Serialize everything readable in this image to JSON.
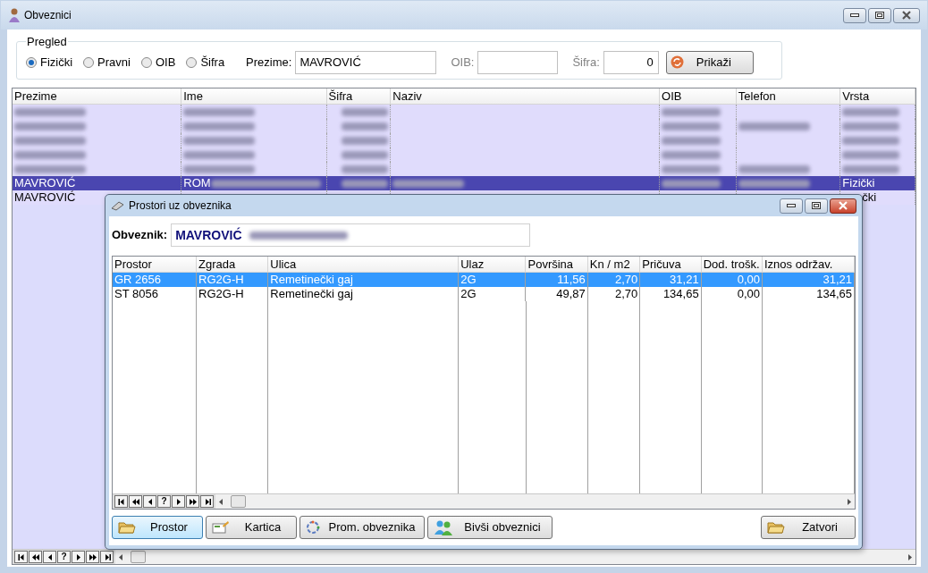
{
  "window": {
    "title": "Obveznici"
  },
  "filter": {
    "title": "Pregled",
    "radios": [
      {
        "label": "Fizički",
        "selected": true
      },
      {
        "label": "Pravni",
        "selected": false
      },
      {
        "label": "OIB",
        "selected": false
      },
      {
        "label": "Šifra",
        "selected": false
      }
    ],
    "prezime": {
      "label": "Prezime:",
      "value": "MAVROVIĆ"
    },
    "oib": {
      "label": "OIB:"
    },
    "sifra": {
      "label": "Šifra:",
      "value": "0"
    },
    "button": "Prikaži"
  },
  "table": {
    "columns": [
      "Prezime",
      "Ime",
      "Šifra",
      "Naziv",
      "OIB",
      "Telefon",
      "Vrsta"
    ],
    "rows": [
      {
        "selected": false,
        "cells": [
          {
            "blurred": true
          },
          {
            "blurred": true
          },
          {
            "blurred": true
          },
          {
            "blurred": false
          },
          {
            "blurred": true
          },
          {
            "blurred": false
          },
          {
            "blurred": true
          }
        ]
      },
      {
        "selected": false,
        "cells": [
          {
            "blurred": true
          },
          {
            "blurred": true
          },
          {
            "blurred": true
          },
          {
            "blurred": false
          },
          {
            "blurred": true
          },
          {
            "blurred": true
          },
          {
            "blurred": true
          }
        ]
      },
      {
        "selected": false,
        "cells": [
          {
            "blurred": true
          },
          {
            "blurred": true
          },
          {
            "blurred": true
          },
          {
            "blurred": false
          },
          {
            "blurred": true
          },
          {
            "blurred": false
          },
          {
            "blurred": true
          }
        ]
      },
      {
        "selected": false,
        "cells": [
          {
            "blurred": true
          },
          {
            "blurred": true
          },
          {
            "blurred": true
          },
          {
            "blurred": false
          },
          {
            "blurred": true
          },
          {
            "blurred": false
          },
          {
            "blurred": true
          }
        ]
      },
      {
        "selected": false,
        "cells": [
          {
            "blurred": true
          },
          {
            "blurred": true
          },
          {
            "blurred": true
          },
          {
            "blurred": false
          },
          {
            "blurred": true
          },
          {
            "blurred": true
          },
          {
            "blurred": true
          }
        ]
      },
      {
        "selected": true,
        "cells": [
          {
            "text": "MAVROVIĆ",
            "blurred": false
          },
          {
            "text": "ROM",
            "blurred": true
          },
          {
            "blurred": true
          },
          {
            "blurred": true
          },
          {
            "blurred": true
          },
          {
            "blurred": true
          },
          {
            "text": "Fizički",
            "blurred": false
          }
        ]
      },
      {
        "selected": false,
        "cells": [
          {
            "text": "MAVROVIĆ",
            "blurred": false
          },
          {
            "blurred": false
          },
          {
            "blurred": false
          },
          {
            "blurred": false
          },
          {
            "blurred": false
          },
          {
            "blurred": false
          },
          {
            "text": "čki",
            "blurred": false
          }
        ]
      }
    ],
    "nav": [
      {
        "kind": "first"
      },
      {
        "kind": "prev-page"
      },
      {
        "kind": "prev"
      },
      {
        "kind": "help",
        "label": "?"
      },
      {
        "kind": "next"
      },
      {
        "kind": "next-page"
      },
      {
        "kind": "last"
      }
    ]
  },
  "dialog": {
    "title": "Prostori uz obveznika",
    "obveznik": {
      "label": "Obveznik:",
      "value": "MAVROVIĆ"
    },
    "table": {
      "columns": [
        "Prostor",
        "Zgrada",
        "Ulica",
        "Ulaz",
        "Površina",
        "Kn / m2",
        "Pričuva",
        "Dod. trošk.",
        "Iznos održav."
      ],
      "rows": [
        {
          "selected": true,
          "cells": [
            "GR 2656",
            "RG2G-H",
            "Remetinečki gaj",
            "2G",
            "11,56",
            "2,70",
            "31,21",
            "0,00",
            "31,21"
          ]
        },
        {
          "selected": false,
          "cells": [
            "ST 8056",
            "RG2G-H",
            "Remetinečki gaj",
            "2G",
            "49,87",
            "2,70",
            "134,65",
            "0,00",
            "134,65"
          ]
        }
      ]
    },
    "buttons": [
      {
        "label": "Prostor",
        "kind": "folder",
        "selected": true
      },
      {
        "label": "Kartica",
        "kind": "card",
        "selected": false
      },
      {
        "label": "Prom. obveznika",
        "kind": "cycle",
        "selected": false
      },
      {
        "label": "Bivši obveznici",
        "kind": "people",
        "selected": false
      }
    ],
    "close_button": {
      "label": "Zatvori",
      "kind": "folder",
      "selected": false
    }
  }
}
